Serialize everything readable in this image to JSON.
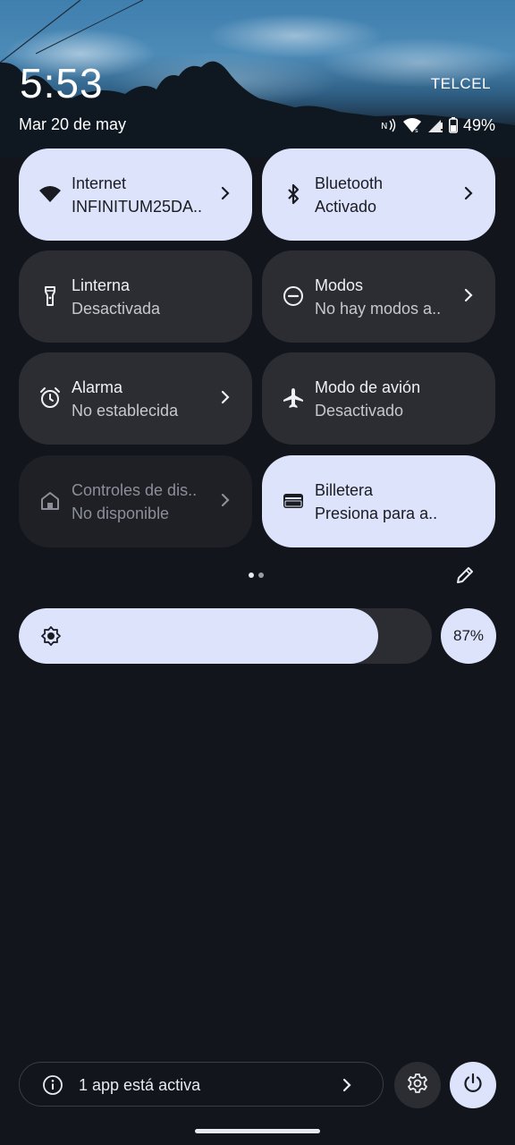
{
  "status_bar": {
    "time": "5:53",
    "carrier": "TELCEL",
    "date": "Mar 20 de may",
    "battery": "49%",
    "icons": [
      "nfc-icon",
      "wifi-calling-icon",
      "cell-signal-icon",
      "battery-icon"
    ]
  },
  "tiles": [
    {
      "title": "Internet",
      "subtitle": "INFINITUM25DA..",
      "icon": "wifi-icon",
      "state": "on",
      "has_chevron": true
    },
    {
      "title": "Bluetooth",
      "subtitle": "Activado",
      "icon": "bluetooth-icon",
      "state": "on",
      "has_chevron": true
    },
    {
      "title": "Linterna",
      "subtitle": "Desactivada",
      "icon": "flashlight-icon",
      "state": "off",
      "has_chevron": false
    },
    {
      "title": "Modos",
      "subtitle": "No hay modos a..",
      "icon": "do-not-disturb-icon",
      "state": "off",
      "has_chevron": true
    },
    {
      "title": "Alarma",
      "subtitle": "No establecida",
      "icon": "alarm-icon",
      "state": "off",
      "has_chevron": true
    },
    {
      "title": "Modo de avión",
      "subtitle": "Desactivado",
      "icon": "airplane-icon",
      "state": "off",
      "has_chevron": false
    },
    {
      "title": "Controles de dis..",
      "subtitle": "No disponible",
      "icon": "home-icon",
      "state": "unavailable",
      "has_chevron": true
    },
    {
      "title": "Billetera",
      "subtitle": "Presiona para a..",
      "icon": "wallet-icon",
      "state": "on",
      "has_chevron": false
    }
  ],
  "pager": {
    "pages": 2,
    "current": 1
  },
  "brightness": {
    "level": 0.87,
    "label": "87%"
  },
  "footer": {
    "active_apps_text": "1 app está activa"
  },
  "colors": {
    "accent": "#dde3fb",
    "tile_off": "#2b2d33",
    "background": "#13151c"
  }
}
